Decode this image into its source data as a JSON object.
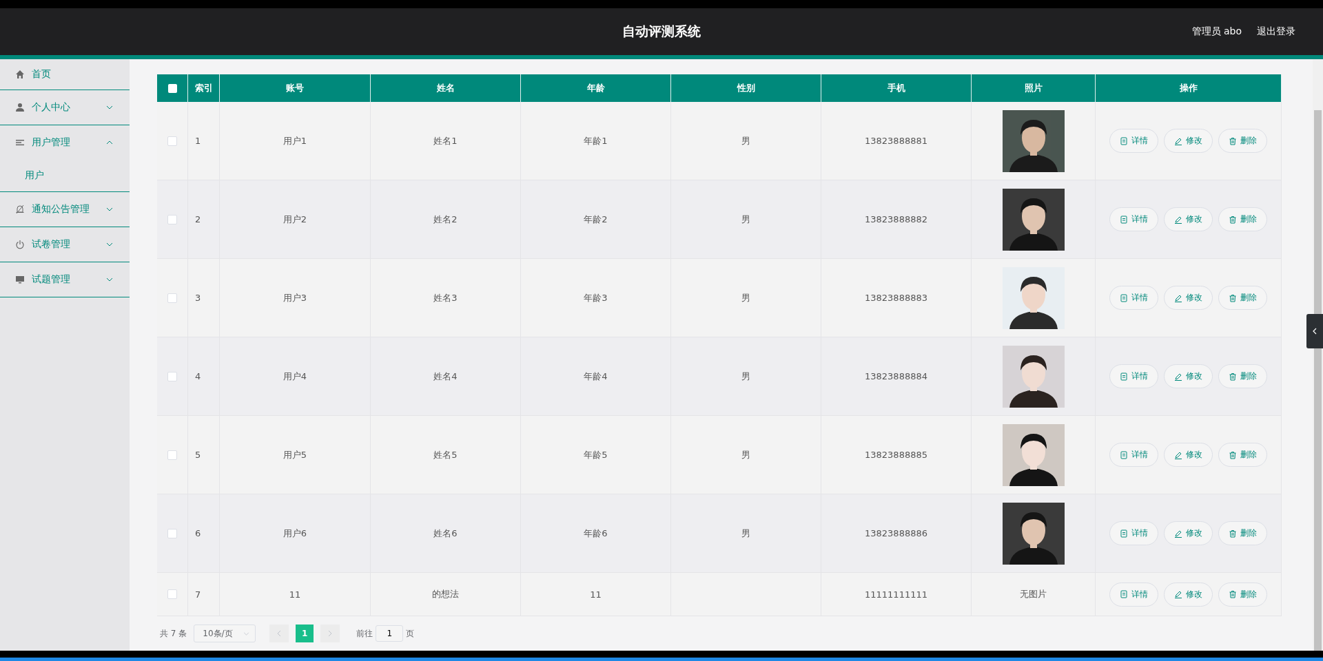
{
  "header": {
    "title": "自动评测系统",
    "user": "管理员 abo",
    "logout": "退出登录"
  },
  "sidebar": {
    "items": [
      {
        "label": "首页"
      },
      {
        "label": "个人中心",
        "expanded": false
      },
      {
        "label": "用户管理",
        "expanded": true,
        "children": [
          {
            "label": "用户"
          }
        ]
      },
      {
        "label": "通知公告管理",
        "expanded": false
      },
      {
        "label": "试卷管理",
        "expanded": false
      },
      {
        "label": "试题管理",
        "expanded": false
      }
    ]
  },
  "table": {
    "select_all_checked": false,
    "columns": [
      "索引",
      "账号",
      "姓名",
      "年龄",
      "性别",
      "手机",
      "照片",
      "操作"
    ],
    "rows": [
      {
        "checked": false,
        "index": "1",
        "account": "用户1",
        "name": "姓名1",
        "age": "年龄1",
        "gender": "男",
        "phone": "13823888881",
        "actions": [
          "详情",
          "修改",
          "删除"
        ]
      },
      {
        "checked": false,
        "index": "2",
        "account": "用户2",
        "name": "姓名2",
        "age": "年龄2",
        "gender": "男",
        "phone": "13823888882",
        "actions": [
          "详情",
          "修改",
          "删除"
        ]
      },
      {
        "checked": false,
        "index": "3",
        "account": "用户3",
        "name": "姓名3",
        "age": "年龄3",
        "gender": "男",
        "phone": "13823888883",
        "actions": [
          "详情",
          "修改",
          "删除"
        ]
      },
      {
        "checked": false,
        "index": "4",
        "account": "用户4",
        "name": "姓名4",
        "age": "年龄4",
        "gender": "男",
        "phone": "13823888884",
        "actions": [
          "详情",
          "修改",
          "删除"
        ]
      },
      {
        "checked": false,
        "index": "5",
        "account": "用户5",
        "name": "姓名5",
        "age": "年龄5",
        "gender": "男",
        "phone": "13823888885",
        "actions": [
          "详情",
          "修改",
          "删除"
        ]
      },
      {
        "checked": false,
        "index": "6",
        "account": "用户6",
        "name": "姓名6",
        "age": "年龄6",
        "gender": "男",
        "phone": "13823888886",
        "actions": [
          "详情",
          "修改",
          "删除"
        ]
      },
      {
        "checked": false,
        "index": "7",
        "account": "11",
        "name": "的想法",
        "age": "11",
        "phone": "11111111111",
        "photo": {
          "kind": "text",
          "text": "无图片"
        },
        "actions": [
          "详情",
          "修改",
          "删除"
        ]
      }
    ]
  },
  "pagination": {
    "total": "共 7 条",
    "page_size": "10条/页",
    "pages": [
      {
        "label": "1",
        "selected": true
      }
    ],
    "goto_label": "前往",
    "goto_value": "1",
    "goto_suffix": "页"
  }
}
